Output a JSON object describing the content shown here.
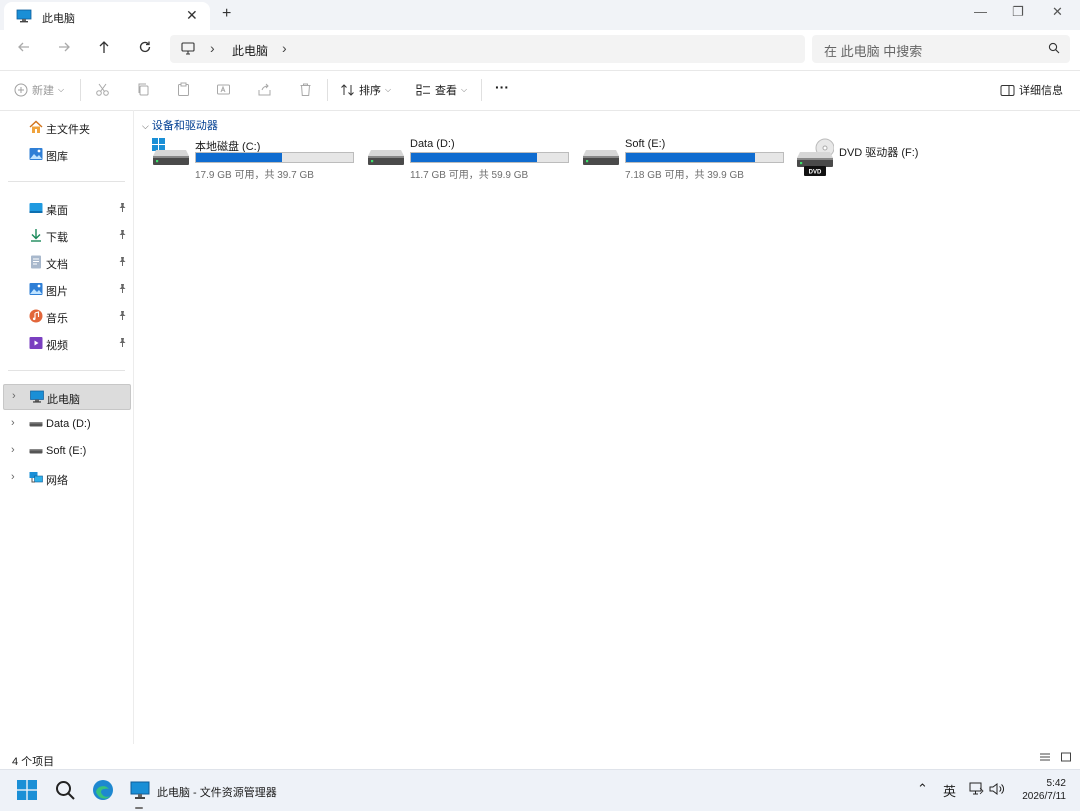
{
  "tab": {
    "title": "此电脑"
  },
  "window": {
    "close_tab_glyph": "✕",
    "new_tab_glyph": "+",
    "min_glyph": "—",
    "max_glyph": "❐",
    "close_glyph": "✕"
  },
  "address": {
    "crumb": "此电脑",
    "sep": "›"
  },
  "search": {
    "placeholder": "在 此电脑 中搜索"
  },
  "toolbar": {
    "new_label": "新建",
    "sort_label": "排序",
    "view_label": "查看",
    "more_label": "···",
    "details_label": "详细信息"
  },
  "sidebar": {
    "quick": [
      {
        "label": "主文件夹",
        "icon": "home-icon"
      },
      {
        "label": "图库",
        "icon": "gallery-icon"
      }
    ],
    "pinned": [
      {
        "label": "桌面",
        "icon": "desktop-icon"
      },
      {
        "label": "下载",
        "icon": "download-icon"
      },
      {
        "label": "文档",
        "icon": "document-icon"
      },
      {
        "label": "图片",
        "icon": "pictures-icon"
      },
      {
        "label": "音乐",
        "icon": "music-icon"
      },
      {
        "label": "视频",
        "icon": "video-icon"
      }
    ],
    "tree": [
      {
        "label": "此电脑",
        "icon": "computer-icon",
        "selected": true
      },
      {
        "label": "Data (D:)",
        "icon": "drive-icon"
      },
      {
        "label": "Soft (E:)",
        "icon": "drive-icon"
      },
      {
        "label": "网络",
        "icon": "network-icon"
      }
    ],
    "pin_glyph": "📌",
    "chevron_glyph": "›"
  },
  "content": {
    "group_header": "设备和驱动器",
    "group_chevron": "⌵",
    "drives": [
      {
        "name": "本地磁盘 (C:)",
        "size": "17.9 GB 可用，共 39.7 GB",
        "used_fraction": 0.55,
        "icon": "windows-drive-icon"
      },
      {
        "name": "Data (D:)",
        "size": "11.7 GB 可用，共 59.9 GB",
        "used_fraction": 0.8,
        "icon": "drive-icon"
      },
      {
        "name": "Soft (E:)",
        "size": "7.18 GB 可用，共 39.9 GB",
        "used_fraction": 0.82,
        "icon": "drive-icon"
      },
      {
        "name": "DVD 驱动器 (F:)",
        "icon": "dvd-drive-icon"
      }
    ]
  },
  "status": {
    "count": "4 个项目"
  },
  "taskbar": {
    "app_label": "此电脑 - 文件资源管理器",
    "ime": "英",
    "time": "5:42",
    "date": "2026/7/11",
    "tray_up_glyph": "⌃"
  },
  "colors": {
    "accent": "#0f6cd0",
    "selected_bg": "#dcdcdc",
    "group_header": "#003e92"
  }
}
